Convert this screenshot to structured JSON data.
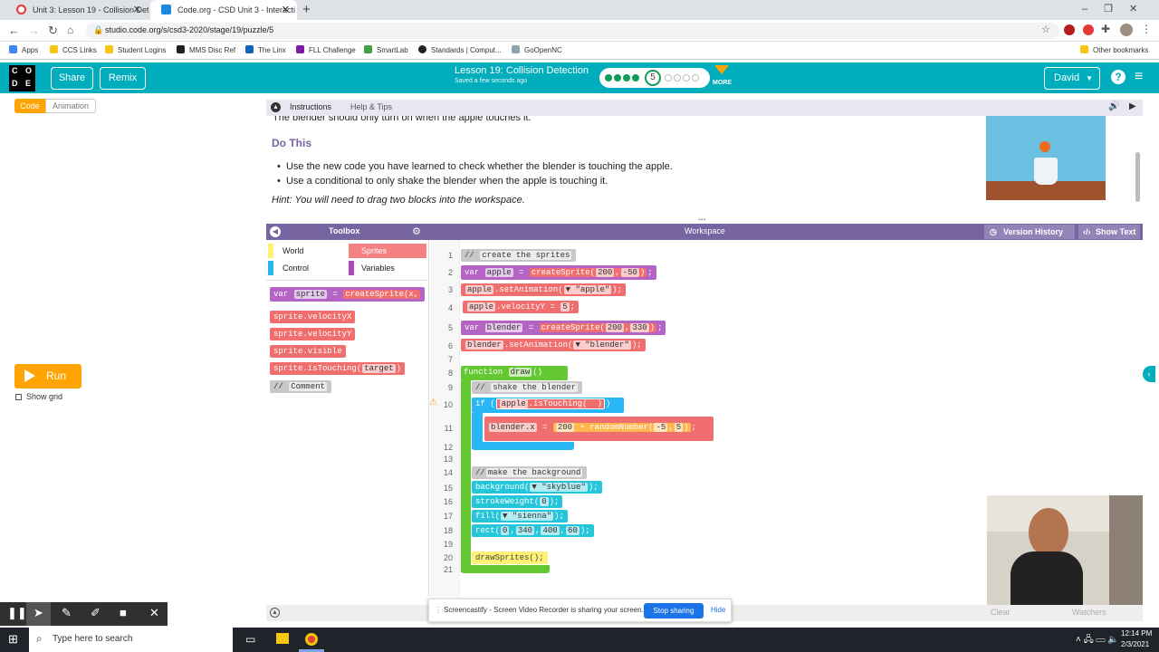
{
  "browser": {
    "tabs": [
      {
        "title": "Unit 3: Lesson 19 - Collision Dete",
        "active": false
      },
      {
        "title": "Code.org - CSD Unit 3 - Interacti",
        "active": true
      }
    ],
    "url": "studio.code.org/s/csd3-2020/stage/19/puzzle/5",
    "bookmarks": [
      "Apps",
      "CCS Links",
      "Student Logins",
      "MMS Disc Ref",
      "The Linx",
      "FLL Challenge",
      "SmartLab",
      "Standards | Comput...",
      "GoOpenNC"
    ],
    "other_bookmarks": "Other bookmarks"
  },
  "header": {
    "logo_letters": [
      "C",
      "O",
      "D",
      "E"
    ],
    "share_label": "Share",
    "remix_label": "Remix",
    "lesson_title": "Lesson 19: Collision Detection",
    "saved_status": "Saved a few seconds ago",
    "current_level": "5",
    "more_label": "MORE",
    "user_name": "David",
    "help_icon": "help-icon",
    "accent": "#00adbc"
  },
  "left": {
    "code_tab": "Code",
    "animation_tab": "Animation",
    "run_label": "Run",
    "show_grid_label": "Show grid"
  },
  "instructions": {
    "tab_instructions": "Instructions",
    "tab_help": "Help & Tips",
    "cut_line": "The blender should only turn on when the apple touches it.",
    "heading": "Do This",
    "bullets": [
      "Use the new code you have learned to check whether the blender is touching the apple.",
      "Use a conditional to only shake the blender when the apple is touching it."
    ],
    "hint": "Hint: You will need to drag two blocks into the workspace."
  },
  "toolbox": {
    "title": "Toolbox",
    "categories": {
      "world": "World",
      "sprites": "Sprites",
      "control": "Control",
      "variables": "Variables"
    },
    "blocks": {
      "var_kw": "var",
      "sprite": "sprite",
      "create": "createSprite",
      "x": "x",
      "velx": ".velocityX",
      "vely": ".velocityY",
      "visible": ".visible",
      "touching": ".isTouching",
      "target": "target",
      "comment_slashes": "//",
      "comment": "Comment"
    }
  },
  "workspace": {
    "title": "Workspace",
    "version_history": "Version History",
    "show_text": "Show Text",
    "line_numbers": [
      "1",
      "2",
      "3",
      "4",
      "5",
      "6",
      "7",
      "8",
      "9",
      "10",
      "11",
      "12",
      "13",
      "14",
      "15",
      "16",
      "17",
      "18",
      "19",
      "20",
      "21"
    ],
    "code": {
      "slashes": "//",
      "c1": "create the sprites",
      "var": "var",
      "apple": "apple",
      "eq": "=",
      "create": "createSprite",
      "a200": "200",
      "m50": "-50",
      "setanim": ".setAnimation",
      "apple_anim": "\"apple\"",
      "vely": ".velocityY",
      "five": "5",
      "blender": "blender",
      "b200": "200",
      "b330": "330",
      "blender_anim": "\"blender\"",
      "function": "function",
      "draw": "draw",
      "c2": "shake the blender",
      "if": "if",
      "touching": ".isTouching",
      "dotx": ".x",
      "n200": "200",
      "plus": "+",
      "rand": "randomNumber",
      "rm5": "-5",
      "r5": "5",
      "c3": "make the background",
      "background": "background",
      "skyblue": "\"skyblue\"",
      "strokeweight": "strokeWeight",
      "zero": "0",
      "fill": "fill",
      "sienna": "\"sienna\"",
      "rect": "rect",
      "r0": "0",
      "r340": "340",
      "r400": "400",
      "r60": "60",
      "drawsprites": "drawSprites();"
    }
  },
  "screencastify": {
    "message": "Screencastify - Screen Video Recorder is sharing your screen.",
    "stop_label": "Stop sharing",
    "hide_label": "Hide"
  },
  "bottom_faded": {
    "clear": "Clear",
    "watchers": "Watchers"
  },
  "taskbar": {
    "search_placeholder": "Type here to search",
    "time": "12:14 PM",
    "date": "2/3/2021"
  }
}
